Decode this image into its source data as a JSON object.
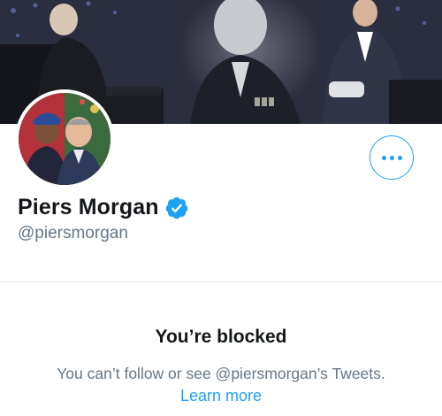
{
  "profile": {
    "display_name": "Piers Morgan",
    "handle": "@piersmorgan",
    "verified": true
  },
  "actions": {
    "more_icon": "more-horizontal-icon"
  },
  "blocked": {
    "title": "You’re blocked",
    "description": "You can’t follow or see @piersmorgan’s Tweets.",
    "learn_more": "Learn more"
  },
  "colors": {
    "accent": "#1da1f2",
    "primary_text": "#14171a",
    "secondary_text": "#657786",
    "divider": "#e1e8ed"
  }
}
